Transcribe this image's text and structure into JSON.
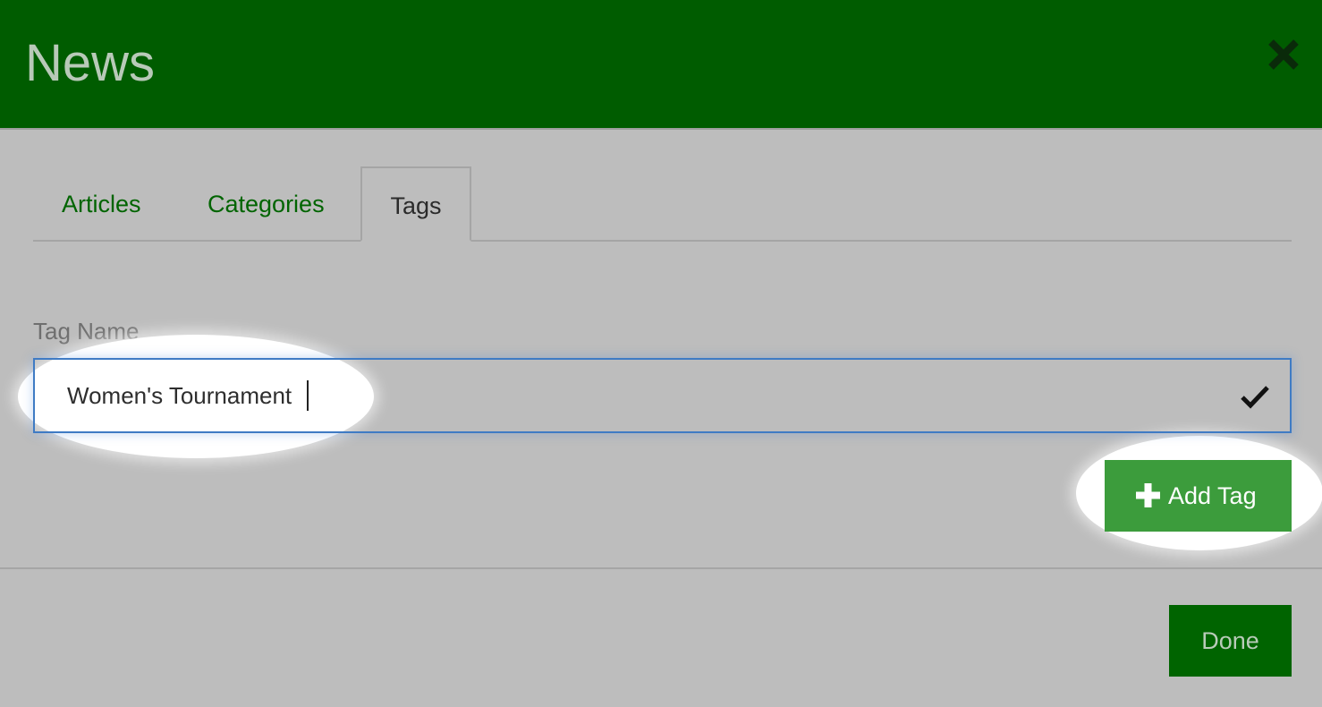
{
  "dialog": {
    "title": "News"
  },
  "tabs": [
    {
      "label": "Articles"
    },
    {
      "label": "Categories"
    },
    {
      "label": "Tags"
    }
  ],
  "tag_form": {
    "field_label": "Tag Name",
    "value": "Women's Tournament",
    "add_button_label": "Add Tag"
  },
  "footer": {
    "done_label": "Done"
  },
  "colors": {
    "header_bg": "#005c00",
    "primary_button": "#3c9c3c",
    "done_button": "#006400",
    "tab_text": "#006400",
    "focus_border": "#3f7bc4"
  },
  "icons": {
    "close": "close-icon",
    "confirm": "checkmark-icon",
    "add": "plus-icon"
  }
}
